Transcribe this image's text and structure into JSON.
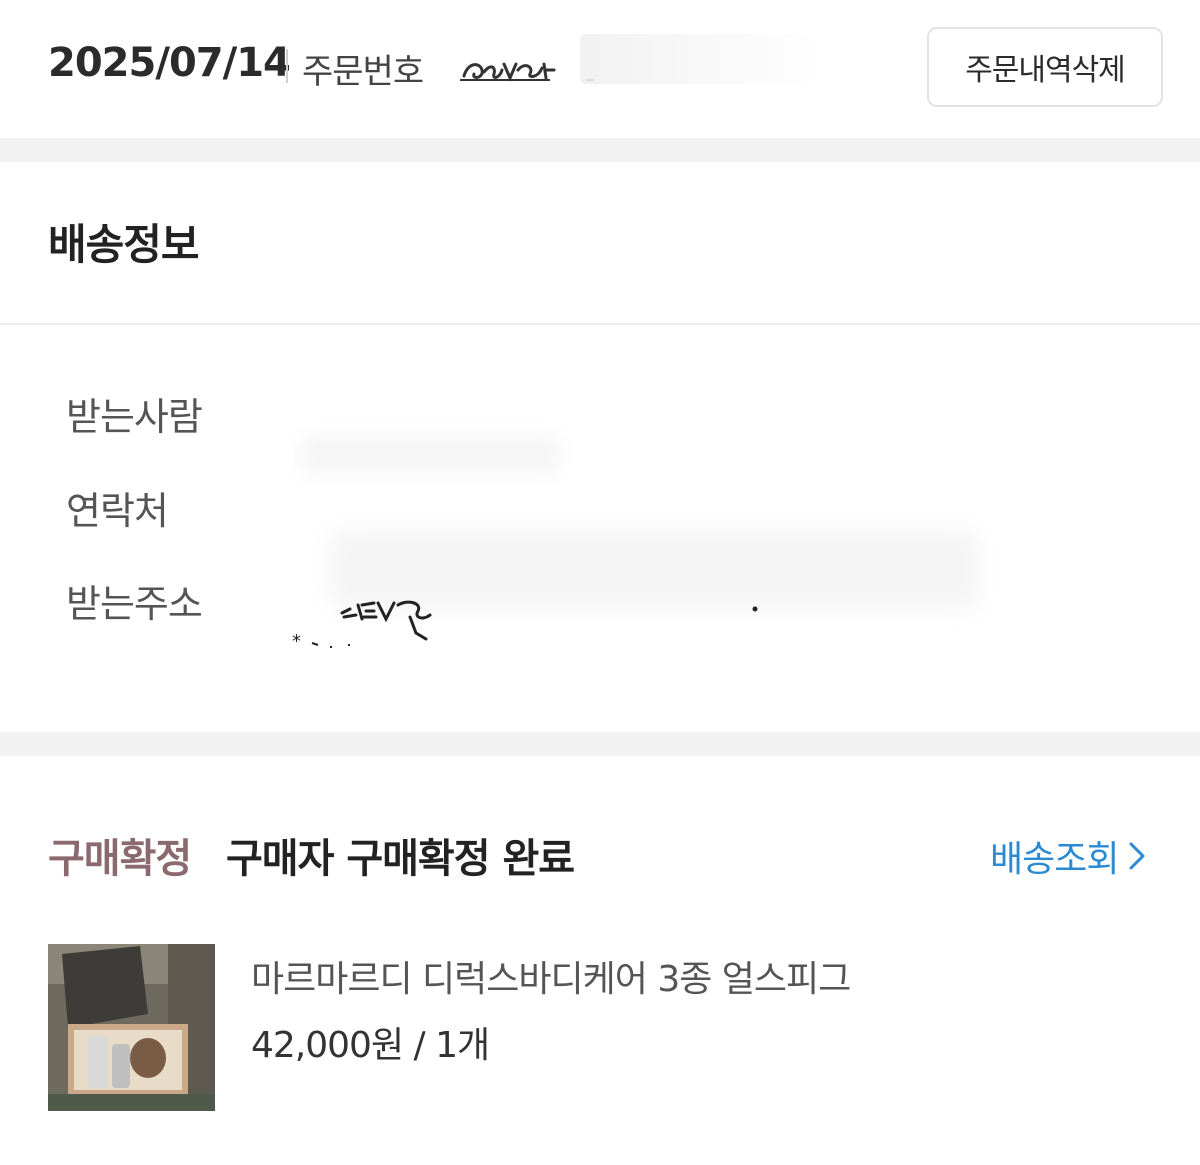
{
  "order": {
    "date": "2025/07/14",
    "number_label": "주문번호",
    "delete_button": "주문내역삭제"
  },
  "shipping": {
    "title": "배송정보",
    "recipient_label": "받는사람",
    "contact_label": "연락처",
    "address_label": "받는주소"
  },
  "status": {
    "badge": "구매확정",
    "text": "구매자 구매확정 완료",
    "track_link": "배송조회"
  },
  "product": {
    "name": "마르마르디 디럭스바디케어 3종 얼스피그",
    "price": "42,000원 / 1개"
  },
  "colors": {
    "status_badge": "#8a6a6f",
    "link": "#2a8ad3",
    "section_gap": "#f2f2f2"
  }
}
